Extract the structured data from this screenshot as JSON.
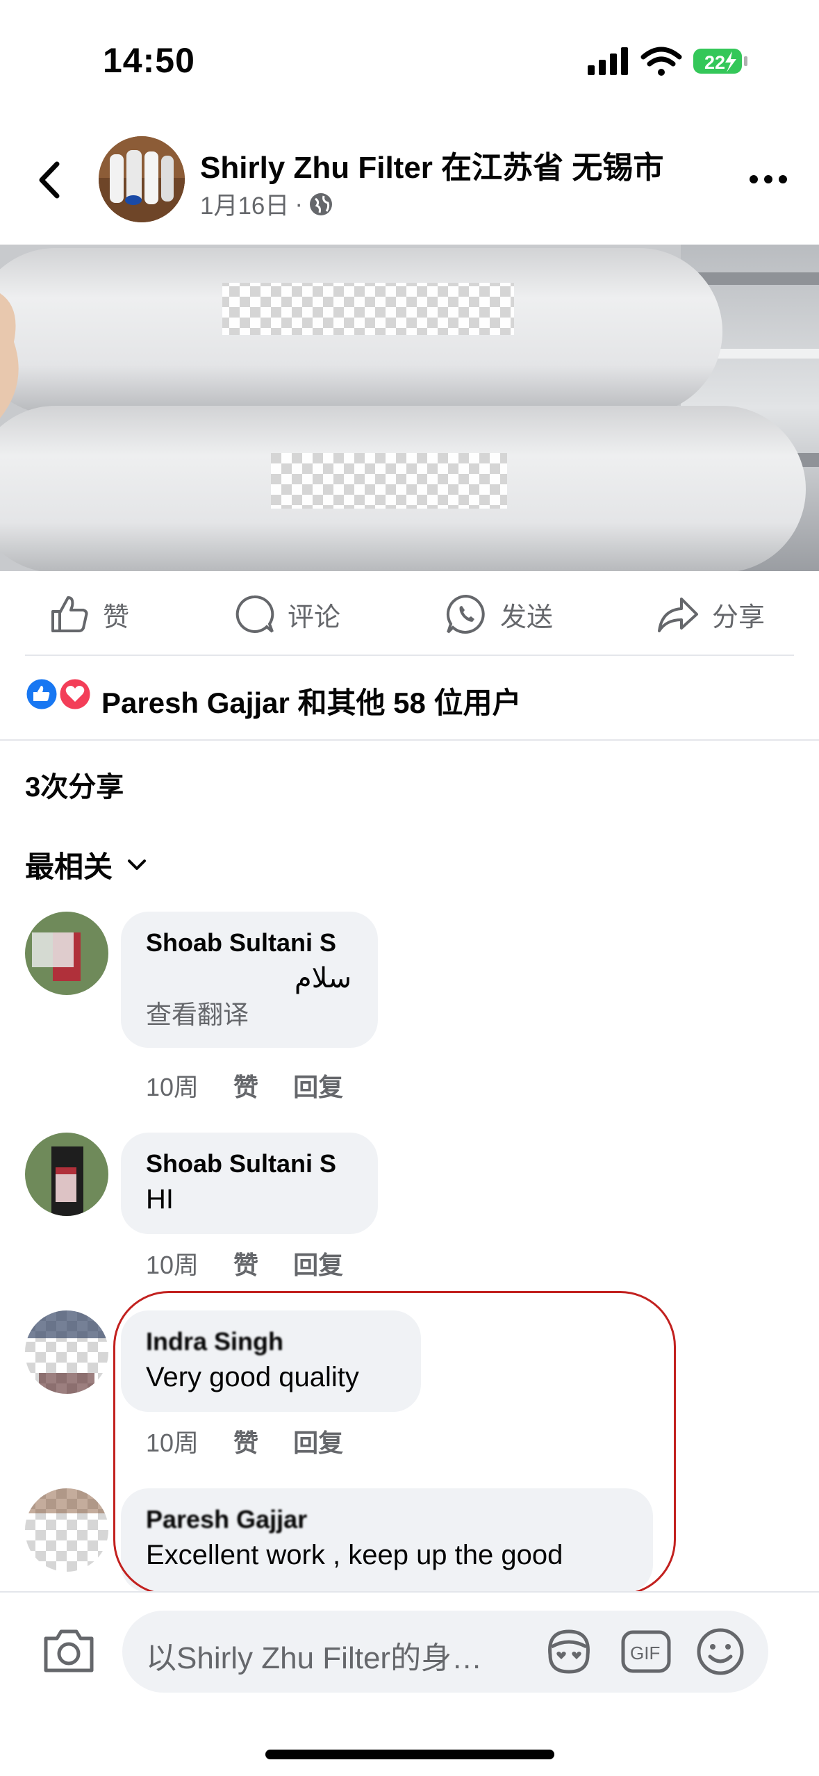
{
  "status_bar": {
    "time": "14:50",
    "battery": "22"
  },
  "post": {
    "author": "Shirly Zhu Filter",
    "location": "在江苏省 无锡市",
    "date": "1月16日",
    "separator": "·"
  },
  "actions": {
    "like": "赞",
    "comment": "评论",
    "send": "发送",
    "share": "分享"
  },
  "reactions_summary": "Paresh Gajjar 和其他 58 位用户",
  "shares_count": "3次分享",
  "sort_label": "最相关",
  "comments": [
    {
      "name": "Shoab Sultani S",
      "text": "سلام",
      "translate": "查看翻译",
      "time": "10周",
      "like": "赞",
      "reply": "回复"
    },
    {
      "name": "Shoab Sultani S",
      "text": "HI",
      "time": "10周",
      "like": "赞",
      "reply": "回复"
    },
    {
      "name": "Indra Singh",
      "text": "Very good quality",
      "time": "10周",
      "like": "赞",
      "reply": "回复"
    },
    {
      "name": "Paresh Gajjar",
      "text": "Excellent work , keep up the good"
    }
  ],
  "composer": {
    "placeholder": "以Shirly Zhu Filter的身…",
    "gif_label": "GIF"
  },
  "colors": {
    "accent_blue": "#1877f2",
    "love_red": "#f33e58",
    "highlight_red": "#c2211f",
    "bubble": "#f0f2f5"
  }
}
